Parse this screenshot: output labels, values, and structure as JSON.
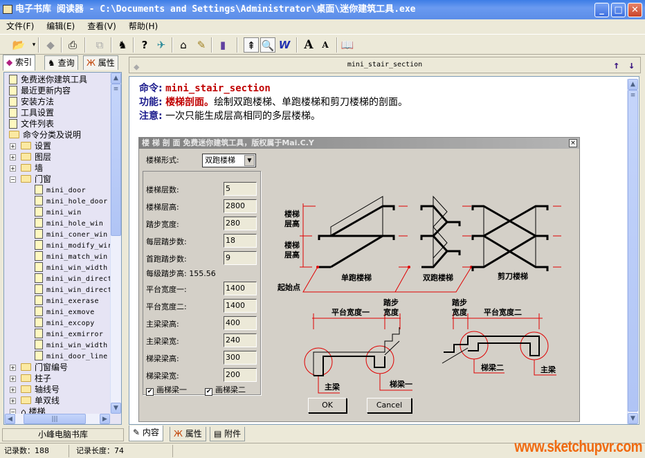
{
  "window": {
    "title": "电子书库 阅读器 - C:\\Documents and Settings\\Administrator\\桌面\\迷你建筑工具.exe",
    "minimize": "_",
    "maximize": "□",
    "close": "✕"
  },
  "menu": [
    "文件(F)",
    "编辑(E)",
    "查看(V)",
    "帮助(H)"
  ],
  "toolbar": {
    "icons": [
      "open-folder-icon",
      "book-icon",
      "print-icon",
      "copy-icon",
      "find-icon",
      "help-icon",
      "web-icon",
      "home-icon",
      "edit-icon",
      "bookmark-icon",
      "top-icon",
      "preview-icon",
      "word-icon",
      "font-larger-icon",
      "font-smaller-icon",
      "open-book-icon"
    ]
  },
  "left_tabs": [
    "索引",
    "查询",
    "属性"
  ],
  "tree": [
    {
      "label": "免费迷你建筑工具",
      "level": 0,
      "type": "doc"
    },
    {
      "label": "最近更新内容",
      "level": 0,
      "type": "doc"
    },
    {
      "label": "安装方法",
      "level": 0,
      "type": "doc"
    },
    {
      "label": "工具设置",
      "level": 0,
      "type": "doc"
    },
    {
      "label": "文件列表",
      "level": 0,
      "type": "doc"
    },
    {
      "label": "命令分类及说明",
      "level": 0,
      "type": "folder"
    },
    {
      "label": "设置",
      "level": 1,
      "type": "folder",
      "toggle": "+"
    },
    {
      "label": "图层",
      "level": 1,
      "type": "folder",
      "toggle": "+"
    },
    {
      "label": "墙",
      "level": 1,
      "type": "folder",
      "toggle": "+"
    },
    {
      "label": "门窗",
      "level": 1,
      "type": "folder",
      "toggle": "-"
    },
    {
      "label": "mini_door",
      "level": 2,
      "type": "doc"
    },
    {
      "label": "mini_hole_door",
      "level": 2,
      "type": "doc"
    },
    {
      "label": "mini_win",
      "level": 2,
      "type": "doc"
    },
    {
      "label": "mini_hole_win",
      "level": 2,
      "type": "doc"
    },
    {
      "label": "mini_coner_win",
      "level": 2,
      "type": "doc"
    },
    {
      "label": "mini_modify_wir",
      "level": 2,
      "type": "doc"
    },
    {
      "label": "mini_match_win",
      "level": 2,
      "type": "doc"
    },
    {
      "label": "mini_win_width",
      "level": 2,
      "type": "doc"
    },
    {
      "label": "mini_win_direct",
      "level": 2,
      "type": "doc"
    },
    {
      "label": "mini_win_direct",
      "level": 2,
      "type": "doc"
    },
    {
      "label": "mini_exerase",
      "level": 2,
      "type": "doc"
    },
    {
      "label": "mini_exmove",
      "level": 2,
      "type": "doc"
    },
    {
      "label": "mini_excopy",
      "level": 2,
      "type": "doc"
    },
    {
      "label": "mini_exmirror",
      "level": 2,
      "type": "doc"
    },
    {
      "label": "mini_win_width",
      "level": 2,
      "type": "doc"
    },
    {
      "label": "mini_door_line",
      "level": 2,
      "type": "doc"
    },
    {
      "label": "门窗编号",
      "level": 1,
      "type": "folder",
      "toggle": "+"
    },
    {
      "label": "柱子",
      "level": 1,
      "type": "folder",
      "toggle": "+"
    },
    {
      "label": "轴线号",
      "level": 1,
      "type": "folder",
      "toggle": "+"
    },
    {
      "label": "单双线",
      "level": 1,
      "type": "folder",
      "toggle": "+"
    },
    {
      "label": "楼梯",
      "level": 1,
      "type": "home",
      "toggle": "-"
    }
  ],
  "left_footer": "小峰电脑书库",
  "right_header": {
    "title": "mini_stair_section",
    "up": "↑",
    "down": "↓"
  },
  "content": {
    "cmd_label": "命令:",
    "cmd_value": "mini_stair_section",
    "func_label": "功能:",
    "func_highlight": "楼梯剖面。",
    "func_text": "绘制双跑楼梯、单跑楼梯和剪刀楼梯的剖面。",
    "note_label": "注意:",
    "note_text": "一次只能生成层高相同的多层楼梯。"
  },
  "dialog": {
    "title": "楼 梯 剖 面   免费迷你建筑工具，版权属于Mai.C.Y",
    "close": "×",
    "stair_type_label": "楼梯形式:",
    "stair_type_value": "双跑楼梯",
    "fields": [
      {
        "label": "楼梯层数:",
        "value": "5"
      },
      {
        "label": "楼梯层高:",
        "value": "2800"
      },
      {
        "label": "踏步宽度:",
        "value": "280"
      },
      {
        "label": "每层踏步数:",
        "value": "18"
      },
      {
        "label": "首跑踏步数:",
        "value": "9"
      }
    ],
    "step_height_text": "每级踏步高: 155.56",
    "fields2": [
      {
        "label": "平台宽度一:",
        "value": "1400"
      },
      {
        "label": "平台宽度二:",
        "value": "1400"
      },
      {
        "label": "主梁梁高:",
        "value": "400"
      },
      {
        "label": "主梁梁宽:",
        "value": "240"
      },
      {
        "label": "梯梁梁高:",
        "value": "300"
      },
      {
        "label": "梯梁梁宽:",
        "value": "200"
      }
    ],
    "check1": {
      "label": "画梯梁一",
      "checked": true
    },
    "check2": {
      "label": "画梯梁二",
      "checked": true
    },
    "ok": "OK",
    "cancel": "Cancel",
    "diagram": {
      "floor_height": "楼梯层高",
      "floor_height_a": "楼梯",
      "floor_height_b": "层高",
      "start_point": "起始点",
      "single": "单跑楼梯",
      "double": "双跑楼梯",
      "scissor": "剪刀楼梯",
      "platform1": "平台宽度一",
      "platform2": "平台宽度二",
      "tread_a": "踏步",
      "tread_b": "宽度",
      "main_beam": "主梁",
      "beam1": "梯梁一",
      "beam2": "梯梁二",
      "line_color": "#000000",
      "dim_color": "#e00000"
    }
  },
  "bottom_tabs": [
    "内容",
    "属性",
    "附件"
  ],
  "status": {
    "records": "记录数：188",
    "length": "记录长度：74"
  },
  "watermark": "www.sketchupvr.com",
  "colors": {
    "title_bar": "#3d7de6",
    "tree_bg": "#e6e4f4",
    "accent_red": "#c00000",
    "label_blue": "#1a1a8c"
  }
}
